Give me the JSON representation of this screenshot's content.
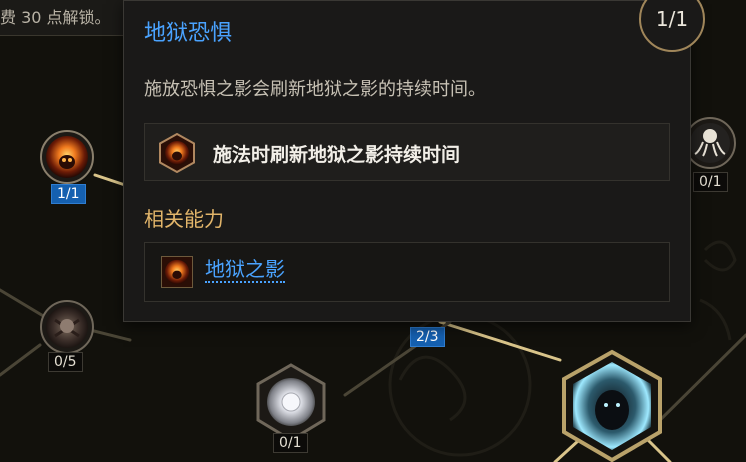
{
  "header_strip": {
    "text": "费 30 点解锁。"
  },
  "nodes": [
    {
      "id": "fire-skull-node",
      "count": "1/1",
      "active": true
    },
    {
      "id": "ghost-node",
      "count": "0/1",
      "active": false
    },
    {
      "id": "skull-spikes-node",
      "count": "0/5",
      "active": false
    },
    {
      "id": "middle-node",
      "count": "2/3",
      "active": true
    },
    {
      "id": "orb-node",
      "count": "0/1",
      "active": false
    }
  ],
  "tooltip": {
    "title": "地狱恐惧",
    "rank": "1/1",
    "description": "施放恐惧之影会刷新地狱之影的持续时间。",
    "modifier_label": "施法时刷新地狱之影持续时间",
    "related_heading": "相关能力",
    "related_skill": "地狱之影"
  },
  "colors": {
    "title": "#4aa3ff",
    "subhead": "#e2b56a",
    "active_badge": "#1560b0",
    "gold_frame": "#b9a26a"
  }
}
